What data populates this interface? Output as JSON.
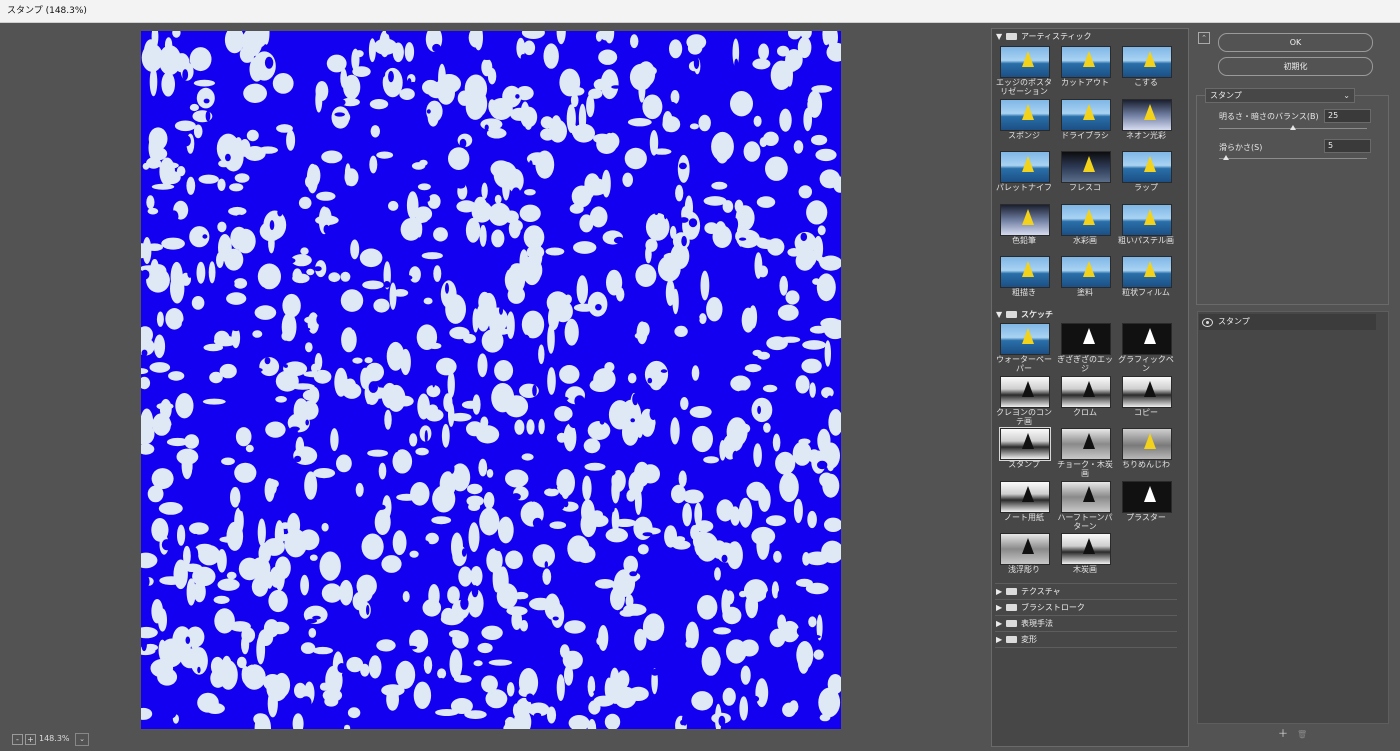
{
  "window": {
    "title": "スタンプ (148.3%)"
  },
  "footer": {
    "zoom": "148.3%",
    "zoom_out": "-",
    "zoom_in": "+",
    "dropdown": "⌄"
  },
  "gallery": {
    "categories": [
      {
        "name": "アーティスティック",
        "expanded": true,
        "arrow": "▼"
      },
      {
        "name": "スケッチ",
        "expanded": true,
        "arrow": "▼"
      },
      {
        "name": "テクスチャ",
        "expanded": false,
        "arrow": "▶"
      },
      {
        "name": "ブラシストローク",
        "expanded": false,
        "arrow": "▶"
      },
      {
        "name": "表現手法",
        "expanded": false,
        "arrow": "▶"
      },
      {
        "name": "変形",
        "expanded": false,
        "arrow": "▶"
      }
    ],
    "artistic": [
      {
        "label": "エッジのポスタリゼーション"
      },
      {
        "label": "カットアウト"
      },
      {
        "label": "こする"
      },
      {
        "label": "スポンジ"
      },
      {
        "label": "ドライブラシ"
      },
      {
        "label": "ネオン光彩"
      },
      {
        "label": "パレットナイフ"
      },
      {
        "label": "フレスコ"
      },
      {
        "label": "ラップ"
      },
      {
        "label": "色鉛筆"
      },
      {
        "label": "水彩画"
      },
      {
        "label": "粗いパステル画"
      },
      {
        "label": "粗描き"
      },
      {
        "label": "塗料"
      },
      {
        "label": "粒状フィルム"
      }
    ],
    "sketch": [
      {
        "label": "ウォーターペーパー"
      },
      {
        "label": "ぎざぎざのエッジ"
      },
      {
        "label": "グラフィックペン"
      },
      {
        "label": "クレヨンのコンテ画"
      },
      {
        "label": "クロム"
      },
      {
        "label": "コピー"
      },
      {
        "label": "スタンプ",
        "selected": true
      },
      {
        "label": "チョーク・木炭画"
      },
      {
        "label": "ちりめんじわ"
      },
      {
        "label": "ノート用紙"
      },
      {
        "label": "ハーフトーンパターン"
      },
      {
        "label": "プラスター"
      },
      {
        "label": "浅浮彫り"
      },
      {
        "label": "木炭画"
      }
    ]
  },
  "panel": {
    "collapse_icon": "⌃",
    "ok": "OK",
    "reset": "初期化",
    "filter_select": "スタンプ",
    "select_chevron": "⌄",
    "params": [
      {
        "label": "明るさ・暗さのバランス(B)",
        "value": "25",
        "level": 0.5
      },
      {
        "label": "滑らかさ(S)",
        "value": "5",
        "level": 0.05
      }
    ],
    "layer": {
      "name": "スタンプ"
    },
    "new_layer": "＋",
    "delete_layer": "🗑"
  },
  "colors": {
    "canvas_blue": "#1400f0",
    "canvas_light": "#dfe9f5"
  }
}
